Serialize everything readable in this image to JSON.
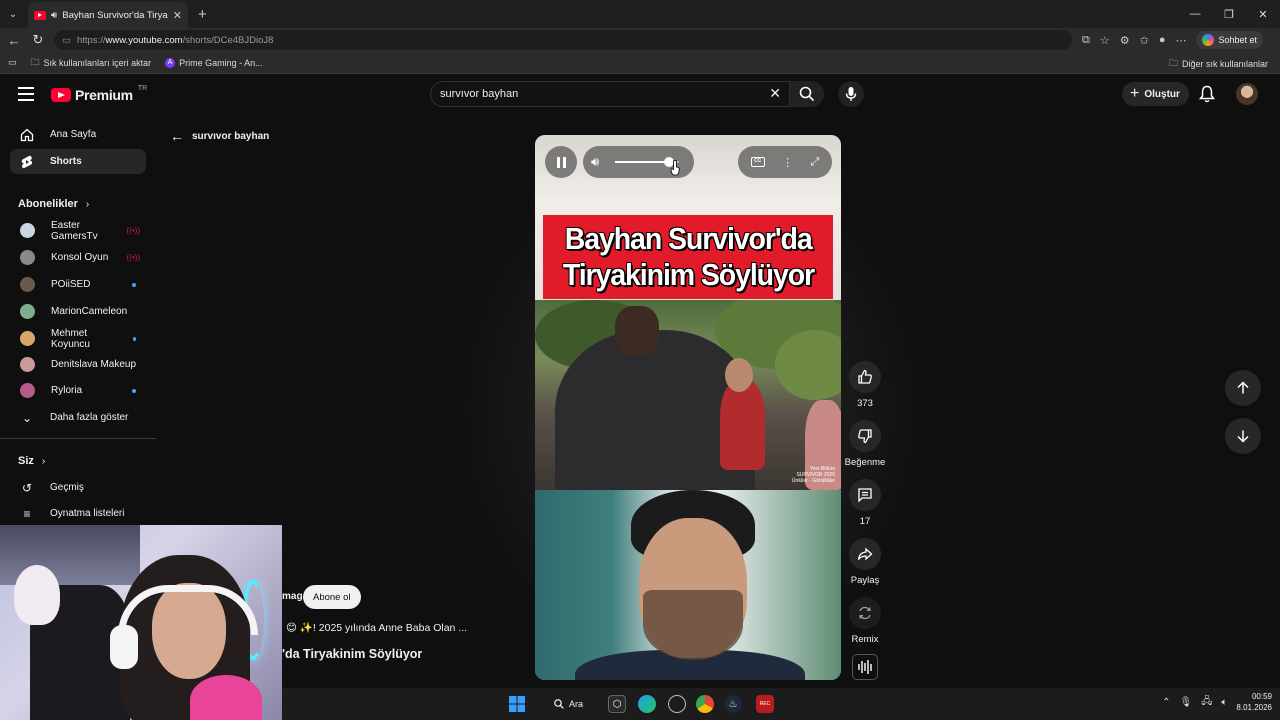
{
  "browser": {
    "tab_title": "Bayhan Survivor'da Tiryakinim Söylüyor",
    "url_prefix": "https://",
    "url_host": "www.youtube.com",
    "url_path": "/shorts/DCe4BJDioJ8",
    "copilot_label": "Sohbet et",
    "favorites": [
      {
        "label": "Sık kullanılanları içeri aktar",
        "icon": "folder-icon"
      },
      {
        "label": "Prime Gaming - An...",
        "icon": "prime-gaming-icon"
      }
    ],
    "other_favorites": "Diğer sık kullanılanlar"
  },
  "youtube": {
    "logo_text": "Premium",
    "country_code": "TR",
    "search_value": "survıvor bayhan",
    "create_label": "Oluştur"
  },
  "sidebar": {
    "main": [
      {
        "label": "Ana Sayfa",
        "icon": "home-icon"
      },
      {
        "label": "Shorts",
        "icon": "shorts-icon",
        "active": true
      }
    ],
    "subscriptions_title": "Abonelikler",
    "subscriptions": [
      {
        "name": "Easter GamersTv",
        "badge": "live",
        "avatar_color": "#c9d6e4"
      },
      {
        "name": "Konsol Oyun",
        "badge": "live",
        "avatar_color": "#8a8a8a"
      },
      {
        "name": "POiiSED",
        "badge": "new",
        "avatar_color": "#6b5a4a"
      },
      {
        "name": "MarionCameleon",
        "badge": "new",
        "avatar_color": "#7fae8a"
      },
      {
        "name": "Mehmet Koyuncu",
        "badge": "new",
        "avatar_color": "#d9a56a"
      },
      {
        "name": "Denitslava Makeup",
        "badge": "",
        "avatar_color": "#c89a9a"
      },
      {
        "name": "Ryloria",
        "badge": "new",
        "avatar_color": "#b55a8a"
      }
    ],
    "show_more": "Daha fazla göster",
    "you_title": "Siz",
    "you_items": [
      {
        "label": "Geçmiş",
        "icon": "history-icon"
      },
      {
        "label": "Oynatma listeleri",
        "icon": "playlists-icon"
      }
    ]
  },
  "shorts": {
    "back_label": "survıvor bayhan",
    "banner_line1": "Bayhan Survivor'da",
    "banner_line2": "Tiryakinim Söylüyor",
    "watermark_line1": "Yeni Bölüm",
    "watermark_line2": "SURVIVOR 2026",
    "watermark_line3": "Ünlüler - Gönüllüler",
    "cc_label": "CC",
    "volume_level": 0.85,
    "likes": "373",
    "dislike_label": "Beğenme",
    "comments": "17",
    "share_label": "Paylaş",
    "remix_label": "Remix",
    "channel_partial": "mag",
    "subscribe_label": "Abone ol",
    "description_partial": "😊 ✨! 2025 yılında Anne Baba Olan ...",
    "title_partial": "'da Tiryakinim Söylüyor"
  },
  "taskbar": {
    "search_label": "Ara",
    "time": "00:59",
    "date": "8.01.2026"
  }
}
